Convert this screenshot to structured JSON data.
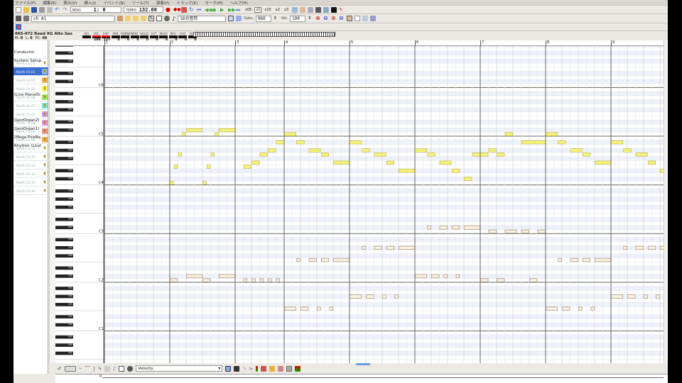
{
  "menu": [
    "ファイル(F)",
    "編集(E)",
    "表示(V)",
    "挿入(I)",
    "イベント(N)",
    "ツール(T)",
    "演奏(P)",
    "トラック(K)",
    "マーク(M)",
    "ヘルプ(H)"
  ],
  "toolbar1": {
    "meas_label": "MEAS",
    "meas_value": "1:   0",
    "tempo_label": "TEMPO",
    "tempo_value": "132.00",
    "zoom": [
      "x05",
      "x1",
      "x15",
      "x2",
      "x3"
    ],
    "zoom_selected": 1
  },
  "toolbar2": {
    "port": "ch A1",
    "note_length": "16分音符",
    "gate_label": "Gate:",
    "gate_value": "960",
    "vel_label": "Vel:",
    "vel_value": "100"
  },
  "instrument": {
    "name": "065-072 Reed XG Alto Sax",
    "m_label": "M:",
    "m": "0",
    "l_label": "L:",
    "l": "0",
    "pc_label": "PC:",
    "pc": "66",
    "controls": [
      {
        "label": "VEL",
        "value": ""
      },
      {
        "label": "VOL",
        "value": "100",
        "red": true
      },
      {
        "label": "EXP",
        "value": "127",
        "red": true
      },
      {
        "label": "PAN",
        "value": "0"
      },
      {
        "label": "P.BEND",
        "value": "0"
      },
      {
        "label": "MOD",
        "value": "0"
      },
      {
        "label": "HOLD",
        "value": "0"
      },
      {
        "label": "CUT",
        "value": "0"
      },
      {
        "label": "RESO",
        "value": "0"
      },
      {
        "label": "REV",
        "value": "0"
      },
      {
        "label": "CHO",
        "value": "0"
      },
      {
        "label": "DLY",
        "value": "0"
      }
    ]
  },
  "tracks": [
    {
      "name": "Conductor",
      "port": ""
    },
    {
      "name": "System Setup",
      "port": "PortA  Ch.01"
    },
    {
      "name": "",
      "port": "PortA  Ch.01",
      "selected": true,
      "color": "#8fb0e8"
    },
    {
      "name": "",
      "port": "PortA  Ch.02",
      "color": "#f3b35a"
    },
    {
      "name": "",
      "port": "PortA  Ch.03",
      "color": "#f7f05a"
    },
    {
      "name": "(Live PianoOr...",
      "port": "PortA  Ch.06",
      "color": "#9be65a"
    },
    {
      "name": "",
      "port": "PortA  Ch.07",
      "color": "#6fe8d8"
    },
    {
      "name": "",
      "port": "PortA  Ch.07",
      "color": "#c79be8"
    },
    {
      "name": "(JazzOrgan2)",
      "port": "PortA  Ch.08",
      "color": "#e88fe0"
    },
    {
      "name": "(JazzOrgan1)",
      "port": "PortA  Ch.08",
      "color": "#f09090"
    },
    {
      "name": "(Mega PickBa...",
      "port": "PortA  Ch.09",
      "color": "#f3b35a"
    },
    {
      "name": "Rhythm (Live!...",
      "port": "PortA  Ch.10"
    },
    {
      "name": "",
      "port": "PortA  Ch.13"
    },
    {
      "name": "",
      "port": "PortA  Ch.13"
    },
    {
      "name": "",
      "port": "PortA  Ch.14"
    },
    {
      "name": "",
      "port": "PortA  Ch.15"
    },
    {
      "name": "",
      "port": "PortA  Ch.16"
    }
  ],
  "ruler": {
    "measures": [
      "1",
      "2",
      "3",
      "4",
      "5",
      "6",
      "7",
      "8",
      "9"
    ],
    "beats_per_measure": [
      4,
      4,
      3,
      4,
      4,
      4,
      4,
      4,
      4
    ]
  },
  "octave_labels": [
    {
      "label": "C6",
      "pitch": 84
    },
    {
      "label": "C5",
      "pitch": 72
    },
    {
      "label": "C4",
      "pitch": 60
    },
    {
      "label": "C3",
      "pitch": 48
    },
    {
      "label": "C2",
      "pitch": 36
    },
    {
      "label": "C1",
      "pitch": 24
    }
  ],
  "bottom": {
    "controller": "Velocity",
    "position": "0"
  },
  "colors": {
    "melody": "#f6f27a",
    "melody_border": "#b9b23a",
    "bass": "#fbf1e0",
    "bass_border": "#9c8460"
  },
  "melody_notes": [
    [
      4,
      60,
      0.25
    ],
    [
      4.25,
      64,
      0.25
    ],
    [
      4.5,
      67,
      0.25
    ],
    [
      4.75,
      72,
      0.25
    ],
    [
      5,
      73,
      1
    ],
    [
      6,
      60,
      0.25
    ],
    [
      6.25,
      64,
      0.25
    ],
    [
      6.5,
      67,
      0.25
    ],
    [
      6.75,
      72,
      0.25
    ],
    [
      7,
      73,
      1
    ],
    [
      8.5,
      64,
      0.5
    ],
    [
      9,
      65,
      0.5
    ],
    [
      9.5,
      67,
      0.5
    ],
    [
      10,
      68,
      0.5
    ],
    [
      10.5,
      70,
      0.5
    ],
    [
      11,
      72,
      0.75
    ],
    [
      11.75,
      70,
      0.5
    ],
    [
      12.5,
      68,
      0.75
    ],
    [
      13.25,
      67,
      0.5
    ],
    [
      14,
      65,
      1
    ],
    [
      15,
      70,
      0.75
    ],
    [
      15.75,
      68,
      0.5
    ],
    [
      16.5,
      67,
      0.75
    ],
    [
      17.25,
      65,
      0.5
    ],
    [
      18,
      63,
      1
    ],
    [
      19,
      68,
      0.75
    ],
    [
      19.75,
      67,
      0.5
    ],
    [
      20.5,
      65,
      0.75
    ],
    [
      21.25,
      63,
      0.5
    ],
    [
      22,
      61,
      0.5
    ],
    [
      22.5,
      67,
      0.5
    ],
    [
      23,
      67,
      0.5
    ],
    [
      23.5,
      68,
      0.5
    ],
    [
      24,
      67,
      0.5
    ],
    [
      24.5,
      72,
      0.5
    ],
    [
      25.5,
      70,
      1.5
    ],
    [
      27,
      72,
      0.75
    ],
    [
      27.75,
      70,
      0.5
    ],
    [
      28.5,
      68,
      0.75
    ],
    [
      29.25,
      67,
      0.5
    ],
    [
      30,
      65,
      1
    ],
    [
      31,
      70,
      0.75
    ],
    [
      31.75,
      68,
      0.5
    ],
    [
      32.5,
      67,
      0.75
    ],
    [
      33.25,
      65,
      0.5
    ],
    [
      34,
      63,
      1
    ]
  ],
  "bass_notes": [
    [
      4,
      36,
      0.5
    ],
    [
      5,
      37,
      1
    ],
    [
      6,
      36,
      0.5
    ],
    [
      7,
      37,
      1
    ],
    [
      8.5,
      36,
      0.25
    ],
    [
      9,
      36,
      0.25
    ],
    [
      9.5,
      36,
      0.25
    ],
    [
      10,
      36,
      0.25
    ],
    [
      10.5,
      36,
      0.25
    ],
    [
      11,
      29,
      0.75
    ],
    [
      12,
      29,
      0.5
    ],
    [
      13,
      29,
      0.25
    ],
    [
      13.75,
      29,
      0.25
    ],
    [
      11.75,
      41,
      0.25
    ],
    [
      12.5,
      41,
      0.5
    ],
    [
      13.25,
      41,
      0.5
    ],
    [
      14,
      41,
      1
    ],
    [
      15,
      32,
      0.75
    ],
    [
      16,
      32,
      0.5
    ],
    [
      17,
      32,
      0.25
    ],
    [
      17.75,
      32,
      0.25
    ],
    [
      15.75,
      44,
      0.25
    ],
    [
      16.5,
      44,
      0.5
    ],
    [
      17.25,
      44,
      0.5
    ],
    [
      18,
      44,
      1
    ],
    [
      19,
      37,
      0.75
    ],
    [
      20,
      37,
      0.5
    ],
    [
      20.75,
      37,
      0.25
    ],
    [
      21.5,
      37,
      0.25
    ],
    [
      19.75,
      49,
      0.25
    ],
    [
      20.5,
      49,
      0.5
    ],
    [
      21.25,
      49,
      0.5
    ],
    [
      22,
      49,
      1
    ],
    [
      23,
      36,
      0.5
    ],
    [
      24,
      36,
      0.5
    ],
    [
      26,
      36,
      0.5
    ],
    [
      23.5,
      48,
      0.5
    ],
    [
      24.5,
      48,
      0.75
    ],
    [
      25.5,
      48,
      0.5
    ],
    [
      26.5,
      48,
      0.5
    ],
    [
      27,
      29,
      0.75
    ],
    [
      28,
      29,
      0.5
    ],
    [
      29,
      29,
      0.25
    ],
    [
      29.75,
      29,
      0.25
    ],
    [
      27.75,
      41,
      0.25
    ],
    [
      28.5,
      41,
      0.5
    ],
    [
      29.25,
      41,
      0.5
    ],
    [
      30,
      41,
      1
    ],
    [
      31,
      32,
      0.75
    ],
    [
      32,
      32,
      0.5
    ],
    [
      33,
      32,
      0.25
    ],
    [
      33.75,
      32,
      0.25
    ],
    [
      31.75,
      44,
      0.25
    ],
    [
      32.5,
      44,
      0.5
    ],
    [
      33.25,
      44,
      0.5
    ],
    [
      34,
      44,
      1
    ]
  ]
}
